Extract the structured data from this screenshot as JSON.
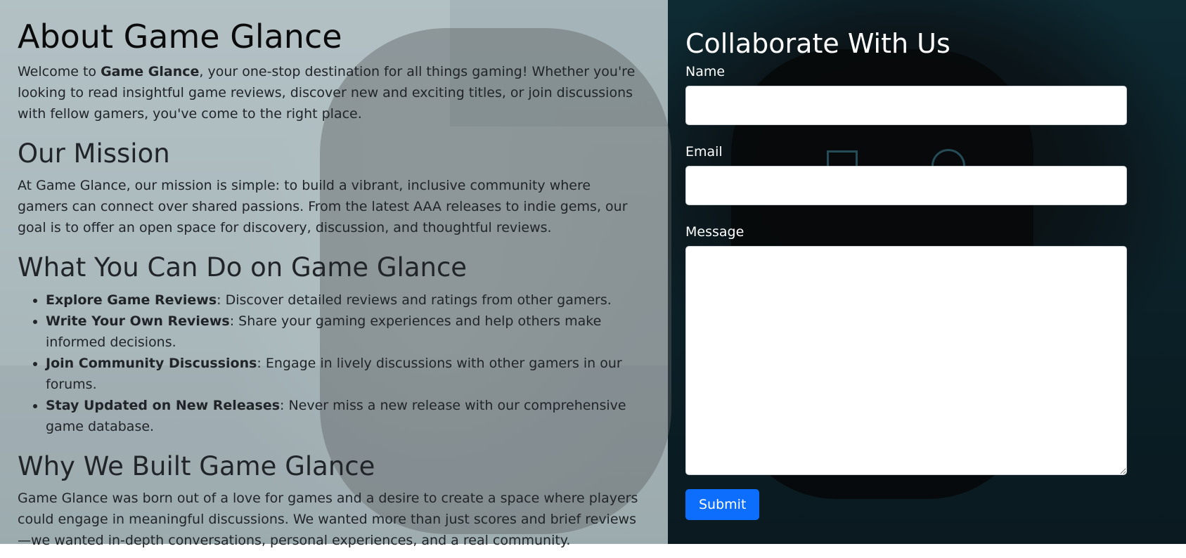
{
  "about": {
    "title": "About Game Glance",
    "intro_pre": "Welcome to ",
    "intro_brand": "Game Glance",
    "intro_post": ", your one-stop destination for all things gaming! Whether you're looking to read insightful game reviews, discover new and exciting titles, or join discussions with fellow gamers, you've come to the right place."
  },
  "mission": {
    "heading": "Our Mission",
    "text": "At Game Glance, our mission is simple: to build a vibrant, inclusive community where gamers can connect over shared passions. From the latest AAA releases to indie gems, our goal is to offer an open space for discovery, discussion, and thoughtful reviews."
  },
  "features": {
    "heading": "What You Can Do on Game Glance",
    "items": [
      {
        "title": "Explore Game Reviews",
        "text": ": Discover detailed reviews and ratings from other gamers."
      },
      {
        "title": "Write Your Own Reviews",
        "text": ": Share your gaming experiences and help others make informed decisions."
      },
      {
        "title": "Join Community Discussions",
        "text": ": Engage in lively discussions with other gamers in our forums."
      },
      {
        "title": "Stay Updated on New Releases",
        "text": ": Never miss a new release with our comprehensive game database."
      }
    ]
  },
  "why": {
    "heading": "Why We Built Game Glance",
    "text": "Game Glance was born out of a love for games and a desire to create a space where players could engage in meaningful discussions. We wanted more than just scores and brief reviews—we wanted in-depth conversations, personal experiences, and a real community."
  },
  "contact": {
    "heading": "Collaborate With Us",
    "name_label": "Name",
    "name_value": "",
    "email_label": "Email",
    "email_value": "",
    "message_label": "Message",
    "message_value": "",
    "submit_label": "Submit"
  },
  "colors": {
    "submit": "#0d6efd",
    "dark_bg": "#0b2027",
    "text": "#212529"
  }
}
